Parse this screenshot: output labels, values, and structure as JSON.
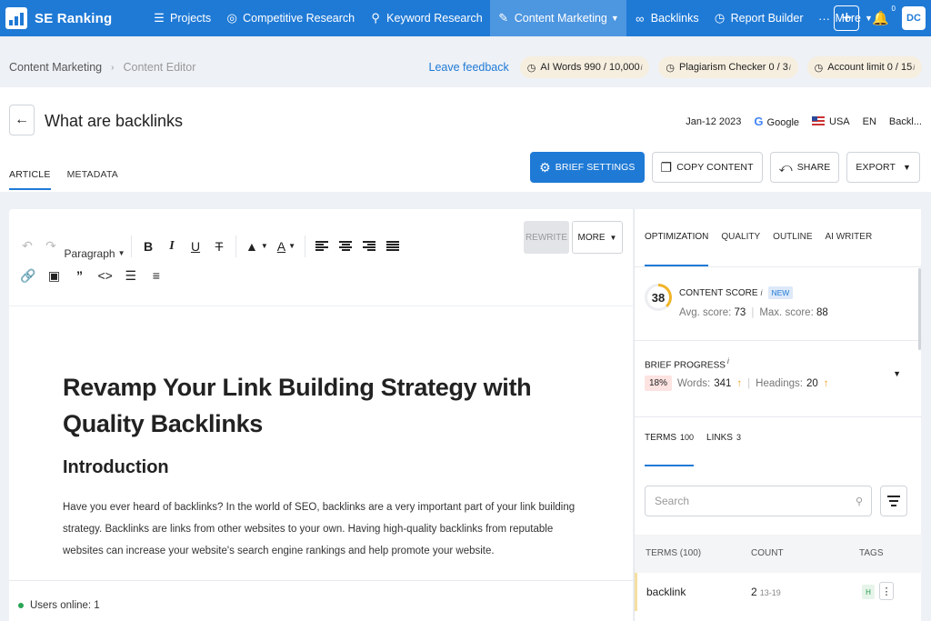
{
  "nav": {
    "brand": "SE Ranking",
    "items": [
      {
        "label": "Projects",
        "icon": "layers-icon"
      },
      {
        "label": "Competitive Research",
        "icon": "target-icon"
      },
      {
        "label": "Keyword Research",
        "icon": "key-icon"
      },
      {
        "label": "Content Marketing",
        "icon": "edit-icon",
        "active": true
      },
      {
        "label": "Backlinks",
        "icon": "link-icon"
      },
      {
        "label": "Report Builder",
        "icon": "clock-icon"
      },
      {
        "label": "More",
        "icon": "dots-icon"
      }
    ],
    "notification_count": "0",
    "avatar_initials": "DC"
  },
  "breadcrumb": {
    "root": "Content Marketing",
    "current": "Content Editor",
    "feedback": "Leave feedback",
    "limits": [
      {
        "label": "AI Words",
        "value": "990 / 10,000",
        "info": "i"
      },
      {
        "label": "Plagiarism Checker",
        "value": "0 / 3",
        "info": "i"
      },
      {
        "label": "Account limit",
        "value": "0 / 15",
        "info": "i"
      }
    ]
  },
  "header": {
    "title": "What are backlinks",
    "date": "Jan-12 2023",
    "engine": "Google",
    "country": "USA",
    "language": "EN",
    "keyword": "Backl...",
    "tabs": [
      "ARTICLE",
      "METADATA"
    ],
    "buttons": {
      "brief_settings": "BRIEF SETTINGS",
      "copy_content": "COPY CONTENT",
      "share": "SHARE",
      "export": "EXPORT"
    }
  },
  "editor": {
    "block_format": "Paragraph",
    "rewrite_label": "REWRITE",
    "more_label": "MORE",
    "h1": "Revamp Your Link Building Strategy with Quality Backlinks",
    "h2": "Introduction",
    "paragraph": "Have you ever heard of backlinks? In the world of SEO, backlinks are a very important part of your link building strategy. Backlinks are links from other websites to your own. Having high-quality backlinks from reputable websites can increase your website's search engine rankings and help promote your website.",
    "users_online": "Users online: 1"
  },
  "panel": {
    "tabs": [
      "OPTIMIZATION",
      "QUALITY",
      "OUTLINE",
      "AI WRITER"
    ],
    "content_score": {
      "label": "CONTENT SCORE",
      "info": "i",
      "badge": "NEW",
      "value": "38",
      "avg_label": "Avg. score:",
      "avg": "73",
      "max_label": "Max. score:",
      "max": "88"
    },
    "brief_progress": {
      "label": "BRIEF PROGRESS",
      "info": "i",
      "percent": "18%",
      "words_label": "Words:",
      "words": "341",
      "headings_label": "Headings:",
      "headings": "20"
    },
    "term_tabs": [
      {
        "label": "TERMS",
        "count": "100"
      },
      {
        "label": "LINKS",
        "count": "3"
      }
    ],
    "search_placeholder": "Search",
    "table": {
      "headers": [
        "TERMS (100)",
        "COUNT",
        "TAGS"
      ],
      "rows": [
        {
          "term": "backlink",
          "count": "2",
          "range": "13-19",
          "tag": "H"
        }
      ]
    }
  }
}
